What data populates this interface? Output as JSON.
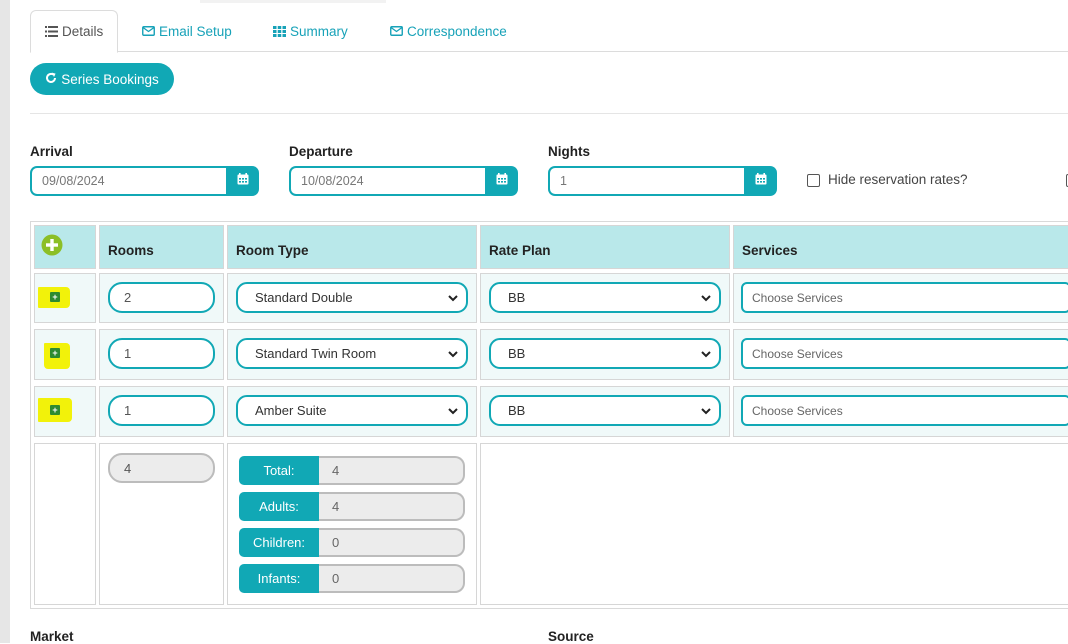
{
  "tabs": [
    {
      "label": "Details",
      "icon": "list-icon",
      "active": true
    },
    {
      "label": "Email Setup",
      "icon": "envelope-icon",
      "active": false
    },
    {
      "label": "Summary",
      "icon": "grid-icon",
      "active": false
    },
    {
      "label": "Correspondence",
      "icon": "envelope-icon",
      "active": false
    }
  ],
  "series_button": {
    "label": "Series Bookings",
    "icon": "refresh-icon"
  },
  "arrival": {
    "label": "Arrival",
    "value": "09/08/2024"
  },
  "departure": {
    "label": "Departure",
    "value": "10/08/2024"
  },
  "nights": {
    "label": "Nights",
    "value": "1"
  },
  "hide_rates": {
    "label": "Hide reservation rates?",
    "checked": false
  },
  "table": {
    "headers": {
      "rooms": "Rooms",
      "room_type": "Room Type",
      "rate_plan": "Rate Plan",
      "services": "Services"
    },
    "rows": [
      {
        "rooms": "2",
        "room_type": "Standard Double",
        "rate_plan": "BB",
        "services": "Choose Services"
      },
      {
        "rooms": "1",
        "room_type": "Standard Twin Room",
        "rate_plan": "BB",
        "services": "Choose Services"
      },
      {
        "rooms": "1",
        "room_type": "Amber Suite",
        "rate_plan": "BB",
        "services": "Choose Services"
      }
    ],
    "rooms_total": "4",
    "occupancy": [
      {
        "label": "Total:",
        "value": "4"
      },
      {
        "label": "Adults:",
        "value": "4"
      },
      {
        "label": "Children:",
        "value": "0"
      },
      {
        "label": "Infants:",
        "value": "0"
      }
    ]
  },
  "bottom": {
    "market_label": "Market",
    "source_label": "Source"
  },
  "colors": {
    "accent": "#11a8b5",
    "header_bg": "#b9e8ea",
    "add_green": "#8cbf26",
    "highlight_yellow": "#f2f20a"
  }
}
